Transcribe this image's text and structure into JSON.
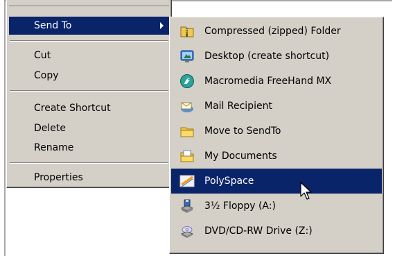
{
  "context_menu": {
    "items": [
      {
        "label": "Send To",
        "selected": true,
        "has_submenu": true
      },
      {
        "label": "Cut"
      },
      {
        "label": "Copy"
      },
      {
        "label": "Create Shortcut"
      },
      {
        "label": "Delete"
      },
      {
        "label": "Rename"
      },
      {
        "label": "Properties"
      }
    ]
  },
  "send_to_submenu": {
    "items": [
      {
        "label": "Compressed (zipped) Folder",
        "icon": "zipped-folder-icon"
      },
      {
        "label": "Desktop (create shortcut)",
        "icon": "desktop-icon"
      },
      {
        "label": "Macromedia FreeHand MX",
        "icon": "freehand-icon"
      },
      {
        "label": "Mail Recipient",
        "icon": "mail-icon"
      },
      {
        "label": "Move to SendTo",
        "icon": "folder-icon"
      },
      {
        "label": "My Documents",
        "icon": "my-documents-icon"
      },
      {
        "label": "PolySpace",
        "icon": "polyspace-icon",
        "selected": true
      },
      {
        "label": "3½ Floppy (A:)",
        "icon": "floppy-drive-icon"
      },
      {
        "label": "DVD/CD-RW Drive (Z:)",
        "icon": "cd-drive-icon"
      }
    ]
  },
  "colors": {
    "menu_background": "#d4d0c8",
    "selection": "#0a246a",
    "selection_text": "#ffffff"
  }
}
